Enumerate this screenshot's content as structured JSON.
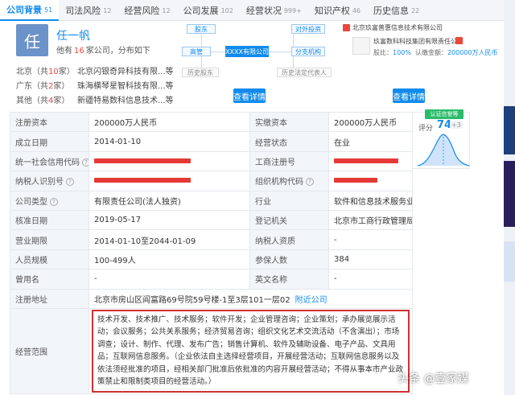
{
  "tabs": [
    {
      "label": "公司背景",
      "count": "51",
      "active": true
    },
    {
      "label": "司法风险",
      "count": "12"
    },
    {
      "label": "经营风险",
      "count": "12"
    },
    {
      "label": "公司发展",
      "count": "102"
    },
    {
      "label": "经营状况",
      "count": "999+"
    },
    {
      "label": "知识产权",
      "count": "46"
    },
    {
      "label": "历史信息",
      "count": "22"
    }
  ],
  "person": {
    "avatar_char": "任",
    "name": "任一帆",
    "sub_prefix": "他有",
    "sub_count": "16",
    "sub_suffix": "家公司，分布如下",
    "regions": [
      {
        "prefix": "北京（共",
        "count": "10",
        "suffix": "家）",
        "companies": "北京闪银奇异科技有限...等"
      },
      {
        "prefix": "广东（共",
        "count": "2",
        "suffix": "家）",
        "companies": "珠海横琴星智科技有限...等"
      },
      {
        "prefix": "其他（共",
        "count": "4",
        "suffix": "家）",
        "companies": "新疆特易数科信息技术...等"
      }
    ]
  },
  "diagram": {
    "shareholder": "股东",
    "executive": "高管",
    "history_shareholder": "历史股东",
    "center": "XXXX有限公司",
    "outbound": "对外投资",
    "branch": "分支机构",
    "history_legal": "历史法定代表人",
    "detail_btn": "查看详情"
  },
  "holding": {
    "title": "北京玖富普惠信息技术有限公司",
    "company": "玖富数科科技集团有限责任公司",
    "ratio_label": "股比：",
    "ratio": "100%",
    "capital_label": "认缴金额：",
    "capital": "200000万人民币",
    "detail_btn": "查看详情"
  },
  "score": {
    "tag": "认证信誉等",
    "label": "评分",
    "value": "74",
    "diff": "+3"
  },
  "info": {
    "reg_capital_label": "注册资本",
    "reg_capital": "200000万人民币",
    "paid_capital_label": "实缴资本",
    "paid_capital": "200000万人民币",
    "est_date_label": "成立日期",
    "est_date": "2014-01-10",
    "status_label": "经营状态",
    "status": "在业",
    "credit_code_label": "统一社会信用代码",
    "biz_reg_label": "工商注册号",
    "taxpayer_label": "纳税人识别号",
    "org_code_label": "组织机构代码",
    "company_type_label": "公司类型",
    "company_type": "有限责任公司(法人独资)",
    "industry_label": "行业",
    "industry": "软件和信息技术服务业",
    "approval_label": "核准日期",
    "approval": "2019-05-17",
    "authority_label": "登记机关",
    "authority": "北京市工商行政管理局房山分局",
    "term_label": "营业期限",
    "term": "2014-01-10至2044-01-09",
    "tax_qual_label": "纳税人资质",
    "tax_qual": "-",
    "staff_label": "人员规模",
    "staff": "100-499人",
    "insured_label": "参保人数",
    "insured": "384",
    "former_label": "曾用名",
    "former": "-",
    "en_name_label": "英文名称",
    "en_name": "-",
    "address_label": "注册地址",
    "address": "北京市房山区阎富路69号院59号楼-1至3层101一层02",
    "nearby": "附近公司",
    "scope_label": "经营范围",
    "scope": "技术开发、技术推广、技术服务；软件开发；企业管理咨询；企业策划；承办展览展示活动；会议服务；公共关系服务；经济贸易咨询；组织文化艺术交流活动（不含演出）；市场调查；设计、制作、代理、发布广告；销售计算机、软件及辅助设备、电子产品、文具用品；互联网信息服务。（企业依法自主选择经营项目，开展经营活动；互联网信息服务以及依法须经批准的项目，经相关部门批准后依批准的内容开展经营活动；不得从事本市产业政策禁止和限制类项目的经营活动。）"
  },
  "watermark": "头条 @壹家媒",
  "colors": {
    "accent": "#128bed",
    "highlight": "#e8483c",
    "label_bg": "#f2f5f9",
    "redact": "#e53935"
  }
}
